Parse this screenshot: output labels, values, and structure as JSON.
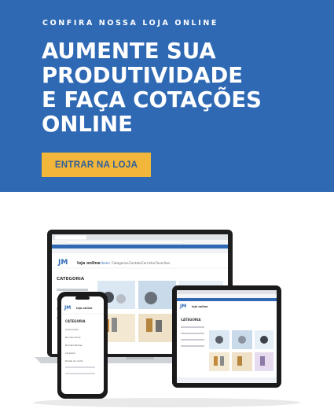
{
  "banner": {
    "eyebrow": "CONFIRA NOSSA LOJA ONLINE",
    "headline_lines": [
      "AUMENTE SUA",
      "PRODUTIVIDADE",
      "E FAÇA COTAÇÕES",
      "ONLINE"
    ],
    "cta_label": "ENTRAR NA LOJA"
  },
  "colors": {
    "hero_bg": "#2f69b4",
    "cta_bg": "#f2b63a",
    "cta_text": "#2f5e9e",
    "store_accent": "#2f69b4"
  },
  "store": {
    "logo": "loja online",
    "nav_items": [
      "Home",
      "Categorias",
      "Contato",
      "Carrinho",
      "Favoritos"
    ],
    "category_heading": "CATEGORIA",
    "category_items": [
      "Automotivo",
      "Buchas Finas",
      "Buchas Brutas",
      "Limpeza",
      "Rodas de corte"
    ]
  },
  "devices": [
    "laptop",
    "tablet",
    "phone"
  ]
}
